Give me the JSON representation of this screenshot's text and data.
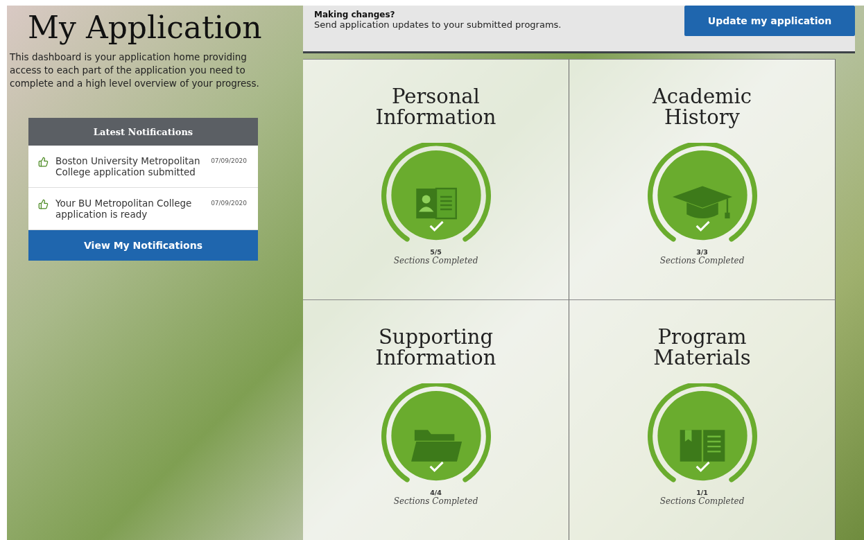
{
  "title": "My Application",
  "intro": "This dashboard is your application home providing access to each part of the application you need to complete and a high level overview of your progress.",
  "notifications": {
    "title": "Latest Notifications",
    "items": [
      {
        "text": "Boston University Metropolitan College application submitted",
        "date": "07/09/2020"
      },
      {
        "text": "Your BU Metropolitan College application is ready",
        "date": "07/09/2020"
      }
    ],
    "button": "View My Notifications"
  },
  "update_bar": {
    "heading": "Making changes?",
    "text": "Send application updates to your submitted programs.",
    "button": "Update my application"
  },
  "sections": [
    {
      "title": "Personal Information",
      "kind": "id-card",
      "count": "5/5",
      "caption": "Sections Completed"
    },
    {
      "title": "Academic History",
      "kind": "graduation-cap",
      "count": "3/3",
      "caption": "Sections Completed"
    },
    {
      "title": "Supporting Information",
      "kind": "folder",
      "count": "4/4",
      "caption": "Sections Completed"
    },
    {
      "title": "Program Materials",
      "kind": "book",
      "count": "1/1",
      "caption": "Sections Completed"
    }
  ]
}
